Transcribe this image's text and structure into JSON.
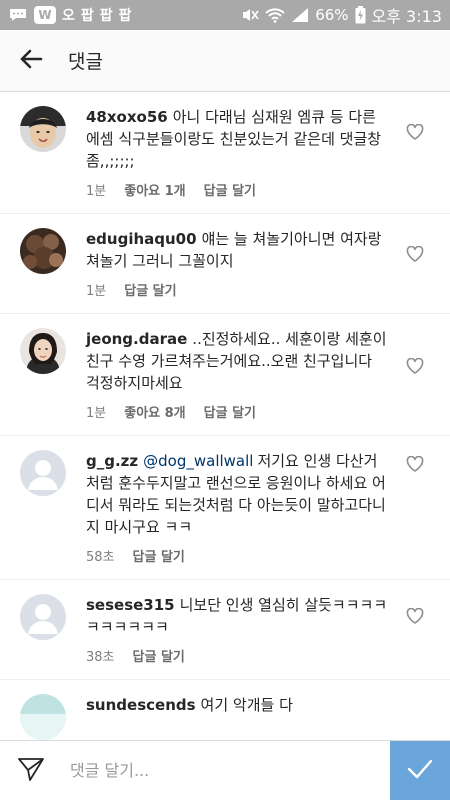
{
  "status_bar": {
    "app_badge": "W",
    "notif_glyphs": [
      "오",
      "팝",
      "팝",
      "팝"
    ],
    "battery": "66%",
    "time": "오후 3:13"
  },
  "header": {
    "title": "댓글"
  },
  "comments": [
    {
      "username": "48xoxo56",
      "mention": "",
      "text": "아니 다래님 심재원 엠큐 등 다른 에셈 식구분들이랑도 친분있는거 같은데 댓글창 좀,,;;;;;",
      "time": "1분",
      "likes": "좋아요 1개",
      "reply": "답글 달기"
    },
    {
      "username": "edugihaqu00",
      "mention": "",
      "text": "얘는 늘 쳐놀기아니면 여자랑 쳐놀기 그러니 그꼴이지",
      "time": "1분",
      "likes": "",
      "reply": "답글 달기"
    },
    {
      "username": "jeong.darae",
      "mention": "",
      "text": "..진정하세요.. 세훈이랑 세훈이친구 수영 가르쳐주는거에요..오랜 친구입니다 걱정하지마세요",
      "time": "1분",
      "likes": "좋아요 8개",
      "reply": "답글 달기"
    },
    {
      "username": "g_g.zz",
      "mention": "@dog_wallwall",
      "text": "저기요 인생 다산거처럼 훈수두지말고 랜선으로 응원이나 하세요 어디서 뭐라도 되는것처럼 다 아는듯이 말하고다니지 마시구요 ㅋㅋ",
      "time": "58초",
      "likes": "",
      "reply": "답글 달기"
    },
    {
      "username": "sesese315",
      "mention": "",
      "text": "니보단 인생 열심히 살듯ㅋㅋㅋㅋㅋㅋㅋㅋㅋㅋ",
      "time": "38초",
      "likes": "",
      "reply": "답글 달기"
    },
    {
      "username": "sundescends",
      "mention": "",
      "text": "여기 악개들 다",
      "time": "",
      "likes": "",
      "reply": ""
    }
  ],
  "input": {
    "placeholder": "댓글 달기..."
  },
  "colors": {
    "status_bar": "#a9a9a9",
    "submit": "#6aa6d9",
    "mention": "#003569",
    "meta": "#7f7f7f"
  },
  "icons": {
    "back": "arrow-left-icon",
    "heart": "heart-outline-icon",
    "send": "paper-plane-icon",
    "submit": "checkmark-icon"
  }
}
